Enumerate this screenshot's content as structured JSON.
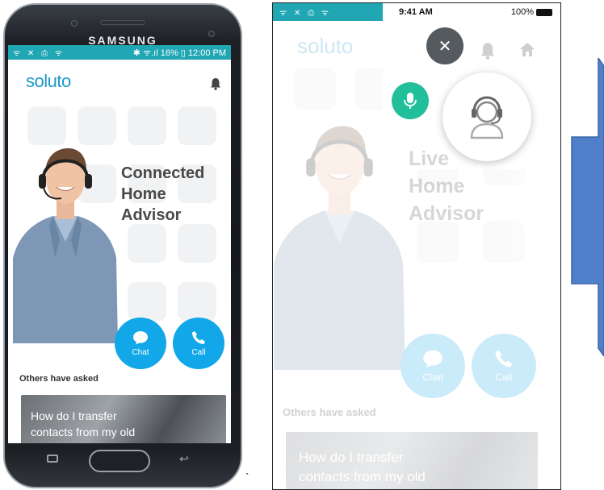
{
  "phone1": {
    "brand": "SAMSUNG",
    "status_bar": {
      "left_icons": "ᯤ ✕ ⎙ ᯤ",
      "right": "✱ ᯤ.ıl 16% ▯ 12:00 PM"
    },
    "logo": "soluto",
    "headline": [
      "Connected",
      "Home",
      "Advisor"
    ],
    "chat_label": "Chat",
    "call_label": "Call",
    "others_asked": "Others have asked",
    "card_text": [
      "How do I transfer",
      "contacts from my old"
    ]
  },
  "separator_tick": "`",
  "phone2": {
    "status_bar": {
      "left_icons": "ᯤ ✕ ⎙ ᯤ",
      "time": "9:41 AM",
      "battery": "100%"
    },
    "logo": "soluto",
    "headline": [
      "Live",
      "Home",
      "Advisor"
    ],
    "chat_label": "Chat",
    "call_label": "Call",
    "others_asked": "Others have asked",
    "card_text": [
      "How do I transfer",
      "contacts from my old"
    ],
    "close_glyph": "✕"
  },
  "colors": {
    "teal_status": "#21a7b4",
    "brand_blue": "#1d99c9",
    "fab_blue": "#12a7e8",
    "mic_green": "#21bf9a",
    "arrow_blue": "#4f80c9"
  },
  "icons": [
    "bell-icon",
    "chat-bubble-icon",
    "phone-icon",
    "microphone-icon",
    "headset-agent-icon",
    "close-icon",
    "home-icon"
  ]
}
